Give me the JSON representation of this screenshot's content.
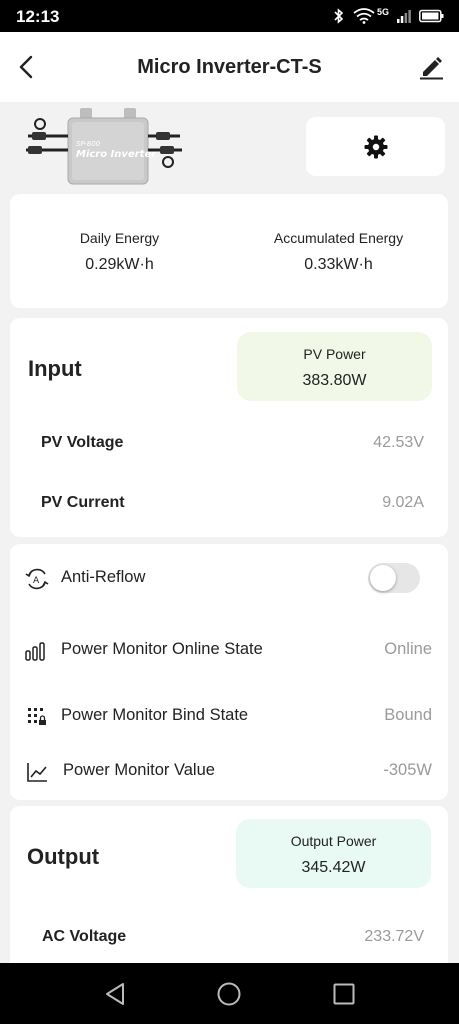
{
  "status_bar": {
    "time": "12:13",
    "network": "5G"
  },
  "header": {
    "title": "Micro Inverter-CT-S"
  },
  "device_image": {
    "model_label": "SP-800",
    "product_label": "Micro Inverter"
  },
  "energy": {
    "daily_label": "Daily Energy",
    "daily_value": "0.29kW·h",
    "accumulated_label": "Accumulated Energy",
    "accumulated_value": "0.33kW·h"
  },
  "input": {
    "title": "Input",
    "pv_power_label": "PV Power",
    "pv_power_value": "383.80W",
    "pv_voltage_label": "PV Voltage",
    "pv_voltage_value": "42.53V",
    "pv_current_label": "PV Current",
    "pv_current_value": "9.02A",
    "box_color": "#f1f8e8"
  },
  "monitor": {
    "anti_reflow_label": "Anti-Reflow",
    "anti_reflow_enabled": false,
    "online_state_label": "Power Monitor Online State",
    "online_state_value": "Online",
    "bind_state_label": "Power Monitor Bind State",
    "bind_state_value": "Bound",
    "value_label": "Power Monitor Value",
    "value_value": "-305W"
  },
  "output": {
    "title": "Output",
    "output_power_label": "Output Power",
    "output_power_value": "345.42W",
    "ac_voltage_label": "AC Voltage",
    "ac_voltage_value": "233.72V",
    "box_color": "#e9faf5"
  },
  "icons": {
    "back": "chevron-left-icon",
    "edit": "pencil-icon",
    "settings": "gear-icon",
    "anti_reflow": "auto-refresh-icon",
    "online_state": "bars-icon",
    "bind_state": "grid-lock-icon",
    "monitor_value": "line-chart-icon"
  }
}
